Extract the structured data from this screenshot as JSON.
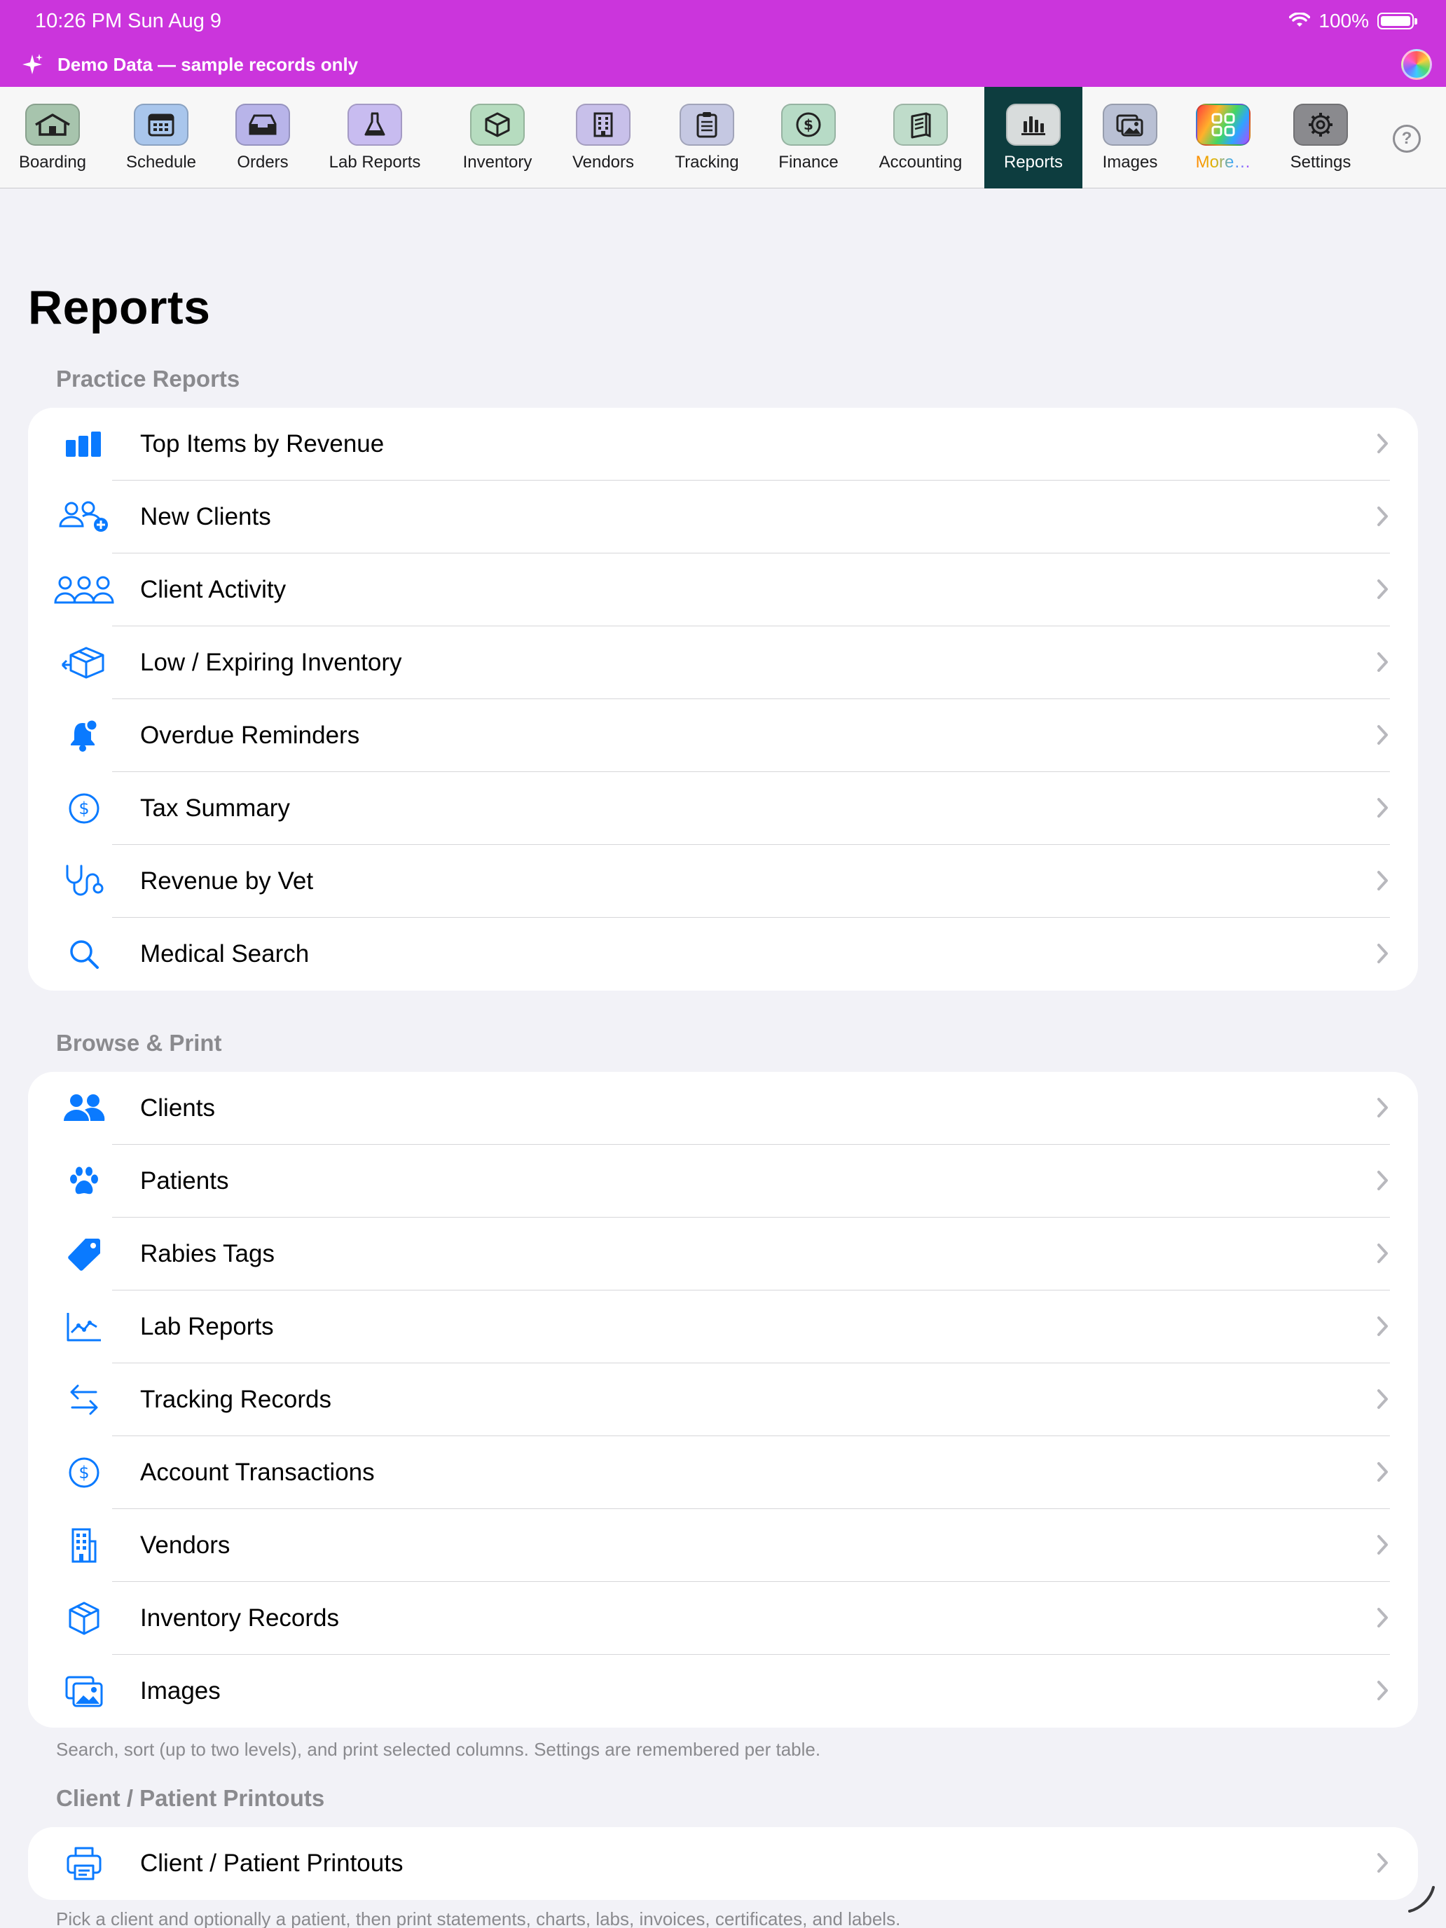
{
  "status_bar": {
    "time": "10:26 PM   Sun Aug 9",
    "battery": "100%"
  },
  "demo_banner": {
    "text": "Demo Data — sample records only"
  },
  "toolbar": [
    {
      "label": "Boarding",
      "icon": "house-icon",
      "color": "#a7c4ad"
    },
    {
      "label": "Schedule",
      "icon": "calendar-icon",
      "color": "#a9c6ec"
    },
    {
      "label": "Orders",
      "icon": "tray-icon",
      "color": "#b8b4e9"
    },
    {
      "label": "Lab Reports",
      "icon": "flask-icon",
      "color": "#c8bcf0"
    },
    {
      "label": "Inventory",
      "icon": "box-icon",
      "color": "#b6dcbf"
    },
    {
      "label": "Vendors",
      "icon": "building-icon",
      "color": "#c8c0ea"
    },
    {
      "label": "Tracking",
      "icon": "clipboard-icon",
      "color": "#c5c8e2"
    },
    {
      "label": "Finance",
      "icon": "dollar-circle-icon",
      "color": "#b7dbc6"
    },
    {
      "label": "Accounting",
      "icon": "ledger-icon",
      "color": "#bfdcca"
    },
    {
      "label": "Reports",
      "icon": "bar-chart-icon",
      "color": "#d8dcdc",
      "active": true
    },
    {
      "label": "Images",
      "icon": "photos-icon",
      "color": "#b9c0d4"
    },
    {
      "label": "More…",
      "icon": "grid-icon",
      "color": "#ff6a3d"
    },
    {
      "label": "Settings",
      "icon": "gear-icon",
      "color": "#8a8a8e"
    }
  ],
  "help_label": "?",
  "page": {
    "title": "Reports"
  },
  "sections": {
    "practice": {
      "header": "Practice Reports",
      "items": [
        {
          "label": "Top Items by Revenue",
          "icon": "bar-chart-icon"
        },
        {
          "label": "New Clients",
          "icon": "person-add-icon"
        },
        {
          "label": "Client Activity",
          "icon": "people-icon"
        },
        {
          "label": "Low / Expiring Inventory",
          "icon": "box-arrow-icon"
        },
        {
          "label": "Overdue Reminders",
          "icon": "bell-badge-icon"
        },
        {
          "label": "Tax Summary",
          "icon": "dollar-circle-icon"
        },
        {
          "label": "Revenue by Vet",
          "icon": "stethoscope-icon"
        },
        {
          "label": "Medical Search",
          "icon": "search-icon"
        }
      ]
    },
    "browse": {
      "header": "Browse & Print",
      "items": [
        {
          "label": "Clients",
          "icon": "people-fill-icon"
        },
        {
          "label": "Patients",
          "icon": "paw-icon"
        },
        {
          "label": "Rabies Tags",
          "icon": "tag-icon"
        },
        {
          "label": "Lab Reports",
          "icon": "line-chart-icon"
        },
        {
          "label": "Tracking Records",
          "icon": "arrows-icon"
        },
        {
          "label": "Account Transactions",
          "icon": "dollar-circle-icon"
        },
        {
          "label": "Vendors",
          "icon": "building-icon"
        },
        {
          "label": "Inventory Records",
          "icon": "box-icon"
        },
        {
          "label": "Images",
          "icon": "photos-icon"
        }
      ],
      "footnote": "Search, sort (up to two levels), and print selected columns. Settings are remembered per table."
    },
    "printouts": {
      "header": "Client / Patient Printouts",
      "items": [
        {
          "label": "Client / Patient Printouts",
          "icon": "printer-icon"
        }
      ],
      "footnote": "Pick a client and optionally a patient, then print statements, charts, labs, invoices, certificates, and labels."
    }
  },
  "colors": {
    "accent": "#0a7aff",
    "banner": "#cb35dc",
    "active_tab": "#0d3d3f"
  }
}
